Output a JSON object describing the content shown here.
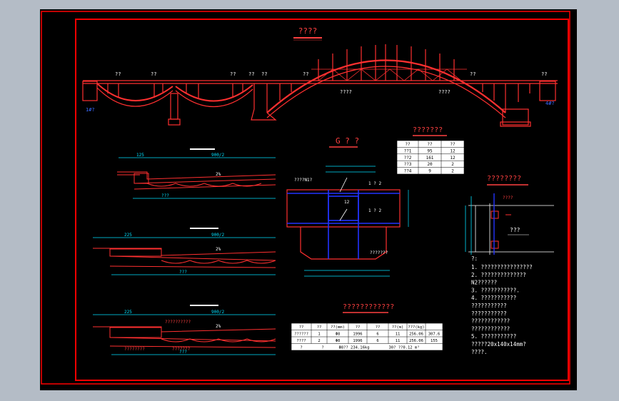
{
  "colors": {
    "canvas": "#000000",
    "frame_bg": "#b4bcc6",
    "border": "#ff0000",
    "dim": "#00e0ff",
    "rebar": "#2233ff",
    "text": "#ffffff",
    "accent": "#ff4040"
  },
  "titles": {
    "elevation": "????",
    "section_g": "G ? ?",
    "table_small": "???????",
    "table_bottom": "????????????",
    "detail_right": "????????"
  },
  "elevation": {
    "labels": [
      "??",
      "??",
      "??",
      "??",
      "??",
      "??",
      "??",
      "??"
    ],
    "left_abut_label": "1#?",
    "right_abut_label": "4#?",
    "arch_label_1": "????",
    "arch_label_2": "????"
  },
  "sections": {
    "sec1": {
      "dim_left": "125",
      "dim_right": "900/2",
      "slope": "2%",
      "bottom": "???"
    },
    "sec2": {
      "dim_left": "225",
      "dim_right": "900/2",
      "slope": "2%",
      "bottom": "???"
    },
    "sec3": {
      "dim_left": "225",
      "dim_right": "900/2",
      "slope": "2%",
      "callout1": "??????????",
      "callout2": "????????",
      "callout3": "???????",
      "bottom": "???"
    }
  },
  "detail_g": {
    "callout": "????N1?",
    "rebar_top": "1 ? 2",
    "rebar_mid": "1 ? 2",
    "mark": "12",
    "bottom_callout": "???????"
  },
  "table_small": {
    "headers": [
      "??",
      "??",
      "??"
    ],
    "rows": [
      [
        "??1",
        "95",
        "12"
      ],
      [
        "??2",
        "161",
        "12"
      ],
      [
        "??3",
        "20",
        "2"
      ],
      [
        "??4",
        "9",
        "2"
      ]
    ]
  },
  "table_bottom": {
    "headers": [
      "??",
      "??",
      "??(mm)",
      "??",
      "??",
      "??(m)",
      "???(kg)"
    ],
    "rows": [
      [
        "??????",
        "1",
        "Φ8",
        "1996",
        "6",
        "11",
        "256.06",
        "307.6"
      ],
      [
        "????",
        "2",
        "Φ8",
        "1996",
        "6",
        "11",
        "256.06",
        "155"
      ]
    ],
    "total": [
      "?",
      "?",
      "Φ8?? 234.16kg",
      "30? ??0.12 m³"
    ]
  },
  "detail_right": {
    "callout": "????",
    "label": "???"
  },
  "notes": {
    "title": "?:",
    "lines": [
      "1. ????????????????",
      "2. ??????????????",
      "   N2??????",
      "3. ???????????.",
      "4. ???????????",
      "   ???????????",
      "   ???????????",
      "   ????????????",
      "   ????????????",
      "5. ???????????",
      "   ?????20x140x14mm?",
      "   ????."
    ]
  }
}
